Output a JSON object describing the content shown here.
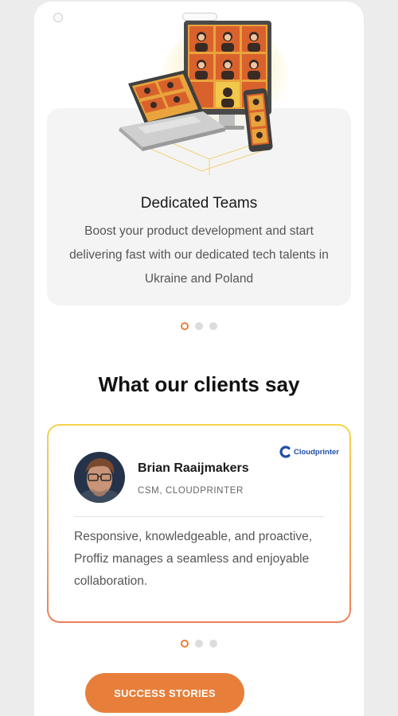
{
  "feature": {
    "title": "Dedicated Teams",
    "description": "Boost your product development and start delivering fast with our dedicated tech talents in Ukraine and Poland",
    "icon": "video-conference-devices-illustration"
  },
  "feature_carousel": {
    "count": 3,
    "active": 0
  },
  "testimonials": {
    "heading": "What our clients say",
    "name": "Brian Raaijmakers",
    "role": "CSM, CLOUDPRINTER",
    "company_logo_text": "Cloudprinter",
    "quote": "Responsive, knowledgeable, and proactive, Proffiz manages a seamless and enjoyable collaboration."
  },
  "testimonial_carousel": {
    "count": 3,
    "active": 0
  },
  "cta": {
    "label": "SUCCESS STORIES"
  },
  "colors": {
    "accent": "#e77f3b",
    "card_border_top": "#f5d44a",
    "card_border_bottom": "#ec7f57",
    "logo_blue": "#1f4fa8"
  }
}
